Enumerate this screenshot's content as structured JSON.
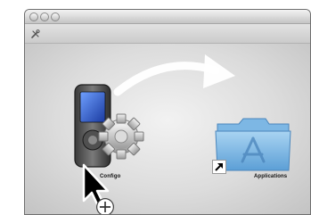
{
  "window": {
    "title": ""
  },
  "toolbar": {
    "icon": "tools-icon"
  },
  "items": {
    "device": {
      "label": "Configo",
      "icon": "media-player-icon"
    },
    "applications": {
      "label": "Applications",
      "icon": "applications-folder-icon"
    }
  },
  "indicators": {
    "arrow": "curved-arrow-icon",
    "alias": "alias-arrow-icon",
    "cursor": "mouse-pointer-icon",
    "copy": "copy-plus-icon"
  },
  "colors": {
    "folder": "#7db7e4",
    "screen": "#2a58c7",
    "window_border": "#6f6f6f"
  }
}
